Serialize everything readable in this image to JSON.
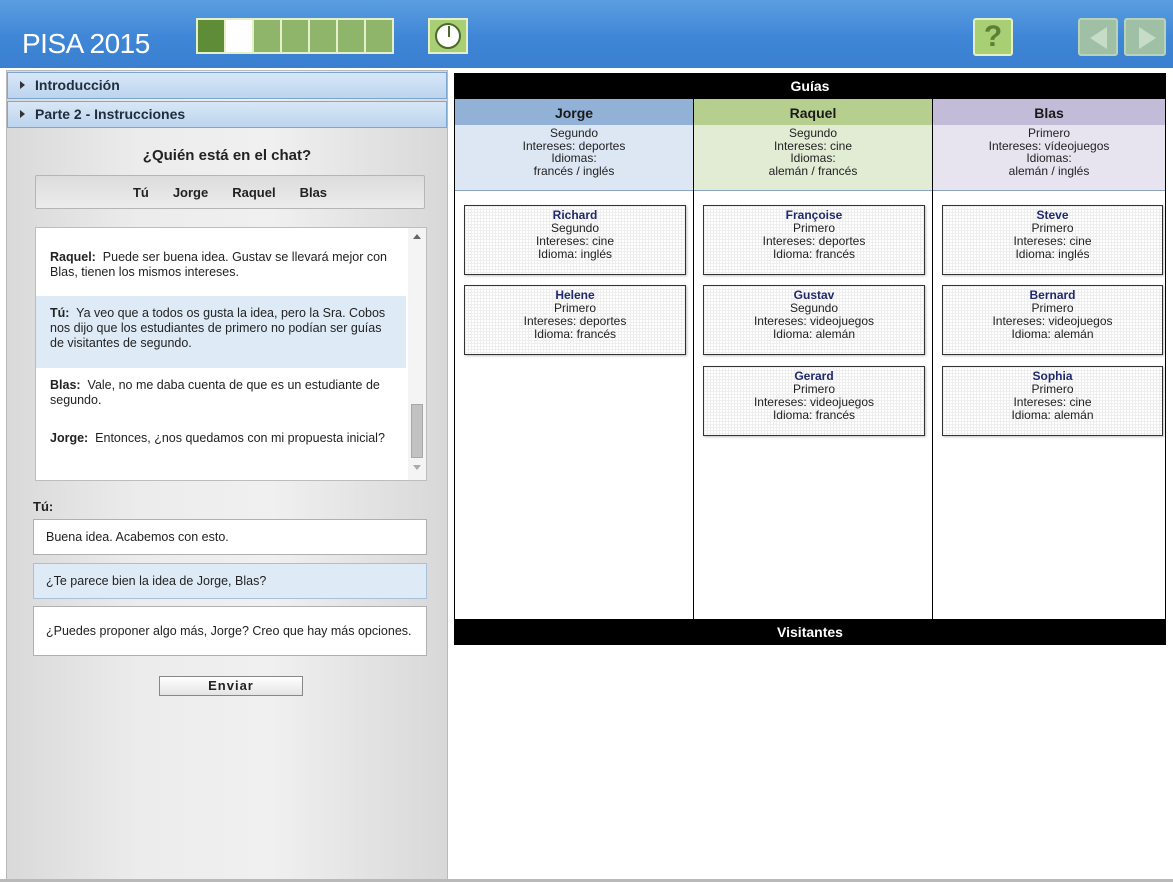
{
  "app": {
    "title": "PISA 2015",
    "progress": {
      "total": 7,
      "completed": 1,
      "current": 2
    },
    "help_label": "?"
  },
  "sidebar": {
    "sections": [
      {
        "label": "Introducción"
      },
      {
        "label": "Parte 2 - Instrucciones"
      }
    ]
  },
  "chat": {
    "heading": "¿Quién está en el chat?",
    "participants": [
      "Tú",
      "Jorge",
      "Raquel",
      "Blas"
    ],
    "messages": [
      {
        "speaker": "Raquel:",
        "text": "Puede ser buena idea. Gustav se llevará mejor con Blas, tienen los mismos intereses.",
        "highlighted": false
      },
      {
        "speaker": "Tú:",
        "text": "Ya veo que a todos os gusta la idea, pero la Sra. Cobos nos dijo que los estudiantes de primero no podían ser guías de visitantes de segundo.",
        "highlighted": true
      },
      {
        "speaker": "Blas:",
        "text": "Vale, no me daba cuenta de que es un estudiante de segundo.",
        "highlighted": false
      },
      {
        "speaker": "Jorge:",
        "text": "Entonces, ¿nos quedamos con mi propuesta inicial?",
        "highlighted": false
      }
    ],
    "you_label": "Tú:",
    "options": [
      {
        "text": "Buena idea. Acabemos con esto.",
        "selected": false
      },
      {
        "text": "¿Te parece bien la idea de Jorge, Blas?",
        "selected": true
      },
      {
        "text": "¿Puedes proponer algo más, Jorge? Creo que hay más opciones.",
        "selected": false
      }
    ],
    "send_label": "Enviar"
  },
  "board": {
    "top_label": "Guías",
    "bottom_label": "Visitantes",
    "columns": [
      {
        "guide": "Jorge",
        "info": [
          "Segundo",
          "Intereses: deportes",
          "Idiomas:",
          "francés / inglés"
        ],
        "color": "#92b1d6",
        "visitors": [
          {
            "name": "Richard",
            "lines": [
              "Segundo",
              "Intereses: cine",
              "Idioma: inglés"
            ]
          },
          {
            "name": "Helene",
            "lines": [
              "Primero",
              "Intereses: deportes",
              "Idioma: francés"
            ]
          }
        ]
      },
      {
        "guide": "Raquel",
        "info": [
          "Segundo",
          "Intereses: cine",
          "Idiomas:",
          "alemán / francés"
        ],
        "color": "#b6cf8f",
        "visitors": [
          {
            "name": "Françoise",
            "lines": [
              "Primero",
              "Intereses: deportes",
              "Idioma: francés"
            ]
          },
          {
            "name": "Gustav",
            "lines": [
              "Segundo",
              "Intereses: videojuegos",
              "Idioma: alemán"
            ]
          },
          {
            "name": "Gerard",
            "lines": [
              "Primero",
              "Intereses: videojuegos",
              "Idioma: francés"
            ]
          }
        ]
      },
      {
        "guide": "Blas",
        "info": [
          "Primero",
          "Intereses: vídeojuegos",
          "Idiomas:",
          "alemán / inglés"
        ],
        "color": "#c2bcd9",
        "visitors": [
          {
            "name": "Steve",
            "lines": [
              "Primero",
              "Intereses: cine",
              "Idioma: inglés"
            ]
          },
          {
            "name": "Bernard",
            "lines": [
              "Primero",
              "Intereses: videojuegos",
              "Idioma: alemán"
            ]
          },
          {
            "name": "Sophia",
            "lines": [
              "Primero",
              "Intereses: cine",
              "Idioma: alemán"
            ]
          }
        ]
      }
    ]
  }
}
